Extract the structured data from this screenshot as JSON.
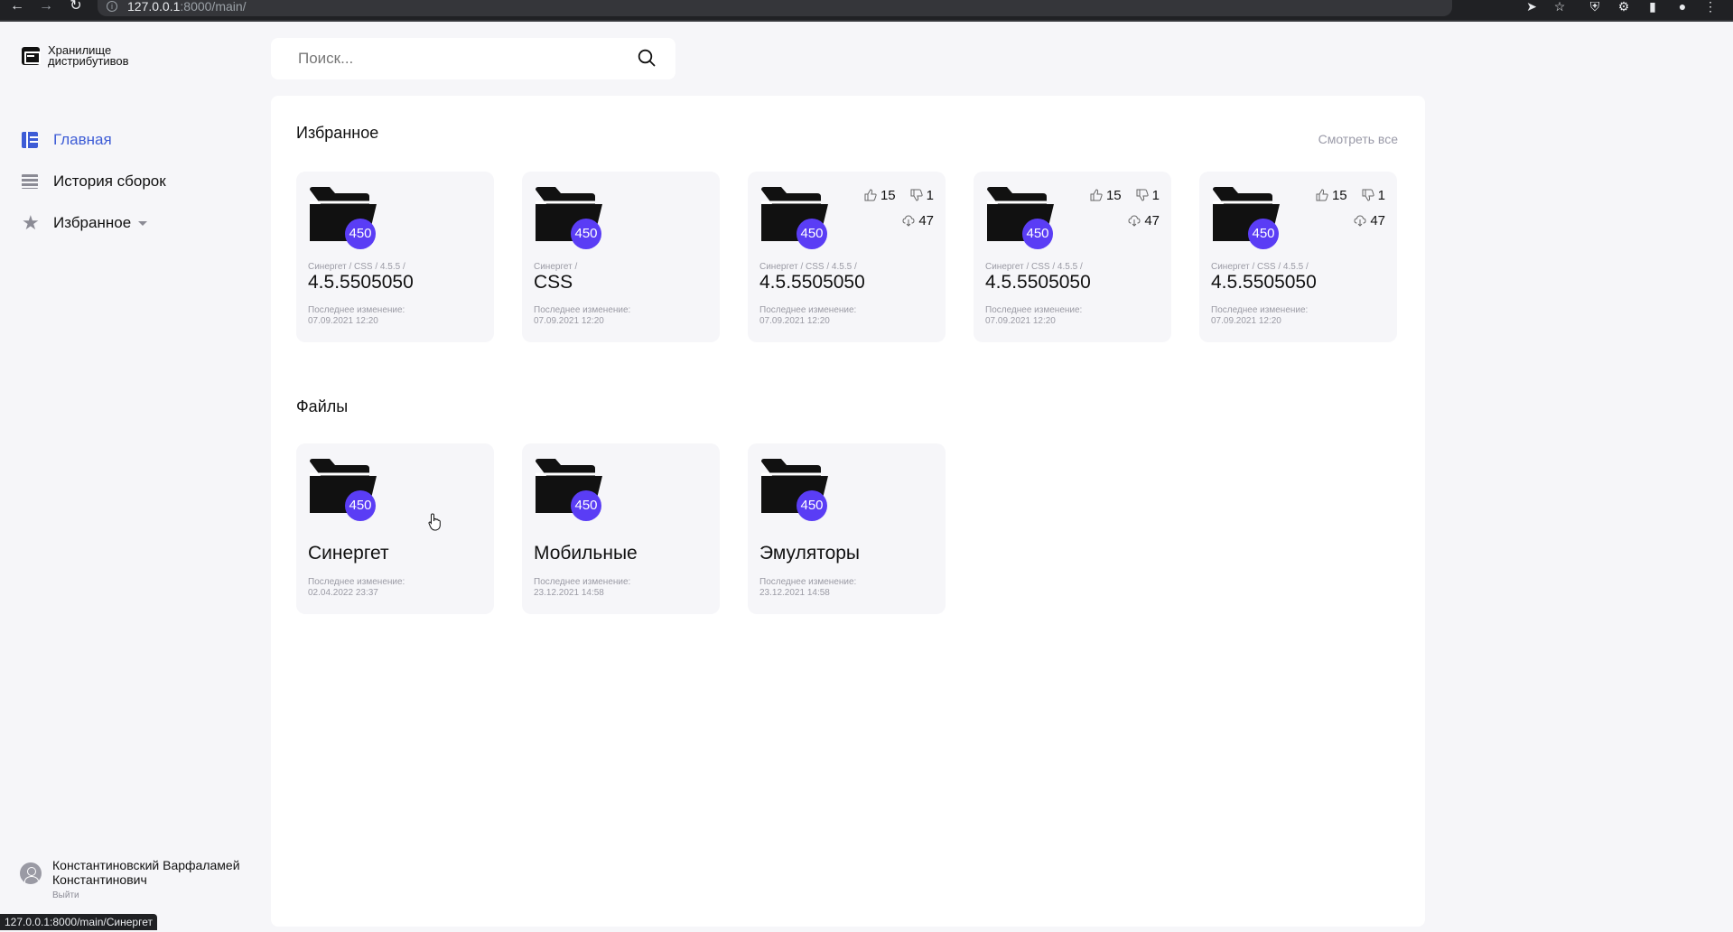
{
  "browser": {
    "url_host": "127.0.0.1",
    "url_rest": ":8000/main/"
  },
  "sidebar": {
    "logo_text": "Хранилище дистрибутивов",
    "items": [
      {
        "label": "Главная",
        "icon": "dashboard-icon",
        "active": true
      },
      {
        "label": "История сборок",
        "icon": "list-icon",
        "active": false
      },
      {
        "label": "Избранное",
        "icon": "star-icon",
        "active": false
      }
    ],
    "user": {
      "name": "Константиновский Варфаламей Константинович",
      "logout": "Выйти"
    }
  },
  "search": {
    "placeholder": "Поиск..."
  },
  "favorites": {
    "title": "Избранное",
    "see_all": "Смотреть все",
    "cards": [
      {
        "badge": "450",
        "crumb": "Синергет / CSS / 4.5.5 /",
        "title": "4.5.5505050",
        "meta_label": "Последнее изменение:",
        "date": "07.09.2021 12:20"
      },
      {
        "badge": "450",
        "crumb": "Синергет /",
        "title": "CSS",
        "meta_label": "Последнее изменение:",
        "date": "07.09.2021 12:20"
      },
      {
        "badge": "450",
        "crumb": "Синергет / CSS / 4.5.5 /",
        "title": "4.5.5505050",
        "meta_label": "Последнее изменение:",
        "date": "07.09.2021 12:20",
        "likes": "15",
        "dislikes": "1",
        "downloads": "47"
      },
      {
        "badge": "450",
        "crumb": "Синергет / CSS / 4.5.5 /",
        "title": "4.5.5505050",
        "meta_label": "Последнее изменение:",
        "date": "07.09.2021 12:20",
        "likes": "15",
        "dislikes": "1",
        "downloads": "47"
      },
      {
        "badge": "450",
        "crumb": "Синергет / CSS / 4.5.5 /",
        "title": "4.5.5505050",
        "meta_label": "Последнее изменение:",
        "date": "07.09.2021 12:20",
        "likes": "15",
        "dislikes": "1",
        "downloads": "47"
      }
    ]
  },
  "files": {
    "title": "Файлы",
    "cards": [
      {
        "badge": "450",
        "title": "Синергет",
        "meta_label": "Последнее изменение:",
        "date": "02.04.2022 23:37"
      },
      {
        "badge": "450",
        "title": "Мобильные",
        "meta_label": "Последнее изменение:",
        "date": "23.12.2021 14:58"
      },
      {
        "badge": "450",
        "title": "Эмуляторы",
        "meta_label": "Последнее изменение:",
        "date": "23.12.2021 14:58"
      }
    ]
  },
  "statusbar": {
    "text": "127.0.0.1:8000/main/Синергет"
  },
  "colors": {
    "accent": "#3d5cd6",
    "badge": "#5a3df5"
  }
}
